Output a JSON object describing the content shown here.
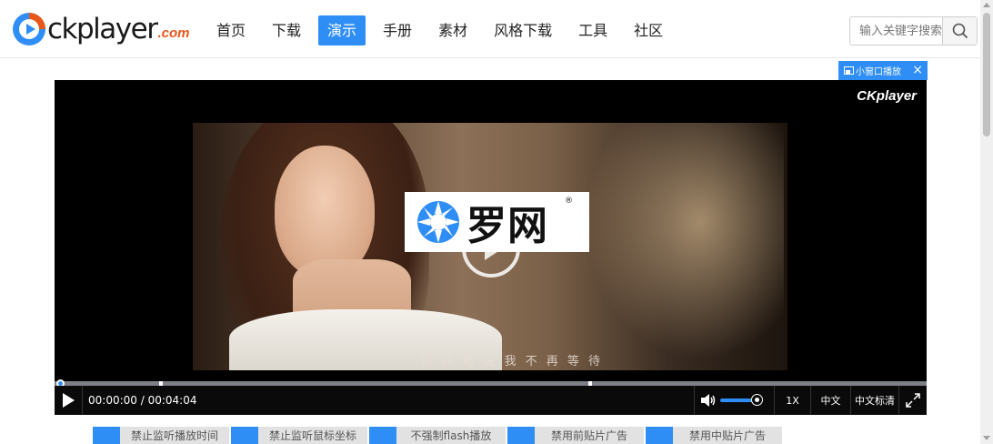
{
  "header": {
    "logo_text": "ckplayer",
    "logo_suffix": ".com",
    "nav": [
      {
        "label": "首页",
        "active": false
      },
      {
        "label": "下载",
        "active": false
      },
      {
        "label": "演示",
        "active": true
      },
      {
        "label": "手册",
        "active": false
      },
      {
        "label": "素材",
        "active": false
      },
      {
        "label": "风格下载",
        "active": false
      },
      {
        "label": "工具",
        "active": false
      },
      {
        "label": "社区",
        "active": false
      }
    ],
    "search": {
      "placeholder": "输入关键字搜索",
      "icon": "search-icon"
    }
  },
  "mini_window": {
    "label": "小窗口播放",
    "close": "×"
  },
  "player": {
    "watermark": "CKplayer",
    "overlay_logo_text": "罗网",
    "overlay_logo_reg": "®",
    "subtitle": "你 你 地 说   我 不 再 等 待",
    "progress_fraction": 0.0,
    "current_time": "00:00:00",
    "duration": "00:04:04",
    "time_display": "00:00:00 / 00:04:04",
    "volume_fraction": 0.9,
    "speed": "1X",
    "language": "中文",
    "subtitle_track": "中文标清"
  },
  "option_buttons": [
    "禁止监听播放时间",
    "禁止监听鼠标坐标",
    "不强制flash播放",
    "禁用前贴片广告",
    "禁用中贴片广告"
  ],
  "colors": {
    "accent": "#2f8ef5",
    "logo_suffix": "#e8561a"
  }
}
